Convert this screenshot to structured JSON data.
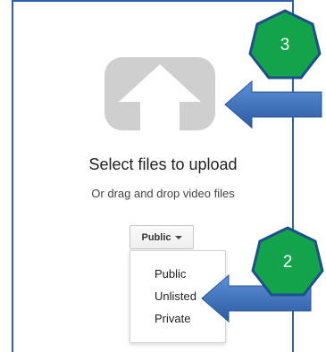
{
  "upload": {
    "title": "Select files to upload",
    "subtitle": "Or drag and drop video files"
  },
  "privacy": {
    "selected": "Public",
    "options": [
      "Public",
      "Unlisted",
      "Private"
    ]
  },
  "annotations": {
    "badge_top": "3",
    "badge_bottom": "2"
  },
  "colors": {
    "frame_blue": "#2f5fa8",
    "arrow_blue": "#3b6fb8",
    "badge_green": "#13a34a",
    "badge_border": "#1f4e8c",
    "upload_icon_gray": "#cfcfcf"
  },
  "icons": {
    "upload": "upload-arrow-icon",
    "dropdown": "caret-down-icon",
    "pointer_top": "arrow-left-icon",
    "pointer_bottom": "arrow-left-icon"
  }
}
